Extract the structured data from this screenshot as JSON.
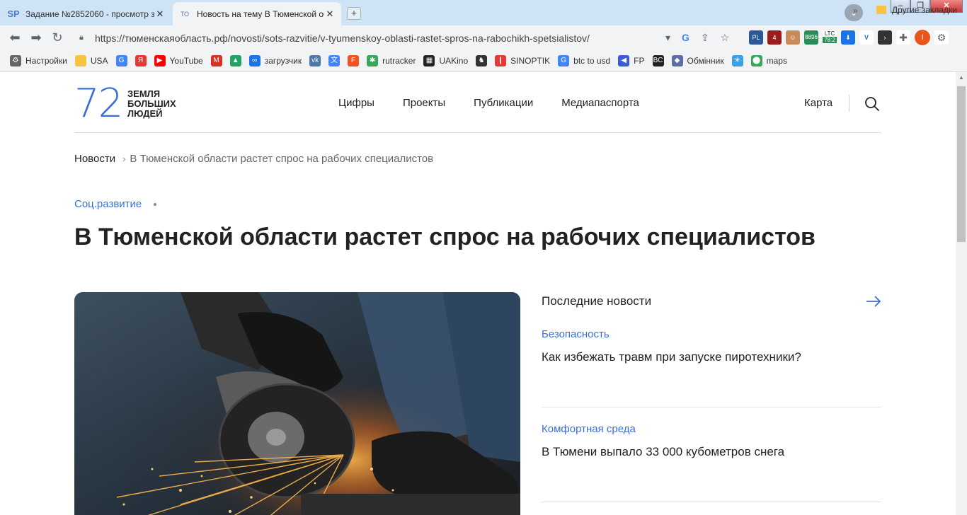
{
  "browser": {
    "tabs": [
      {
        "favicon": "SP",
        "title": "Задание №2852060 - просмотр з"
      },
      {
        "favicon": "ТО",
        "title": "Новость на тему В Тюменской об"
      }
    ],
    "url": "https://тюменскаяобласть.рф/novosti/sots-razvitie/v-tyumenskoy-oblasti-rastet-spros-na-rabochikh-spetsialistov/",
    "extensions": {
      "ltc_label": "LTC",
      "ltc_value": "78.2",
      "badge_4": "4",
      "badge_pl": "PL",
      "badge_value": "8896",
      "avatar_letter": "I"
    },
    "bookmarks": [
      {
        "label": "Настройки",
        "icon": "gear-icon",
        "color": "#666666"
      },
      {
        "label": "USA",
        "icon": "folder-icon",
        "color": "#f5c542"
      },
      {
        "label": "",
        "icon": "google-icon",
        "color": "#4285f4"
      },
      {
        "label": "",
        "icon": "yandex-icon",
        "color": "#e53935"
      },
      {
        "label": "YouTube",
        "icon": "youtube-icon",
        "color": "#ff0000"
      },
      {
        "label": "",
        "icon": "gmail-icon",
        "color": "#d93025"
      },
      {
        "label": "",
        "icon": "drive-icon",
        "color": "#1fa463"
      },
      {
        "label": "загрузчик",
        "icon": "infinity-icon",
        "color": "#1a73e8"
      },
      {
        "label": "",
        "icon": "vk-icon",
        "color": "#4a76a8"
      },
      {
        "label": "",
        "icon": "translate-icon",
        "color": "#4285f4"
      },
      {
        "label": "",
        "icon": "f-icon",
        "color": "#f4511e"
      },
      {
        "label": "rutracker",
        "icon": "rutracker-icon",
        "color": "#3aa757"
      },
      {
        "label": "UAKino",
        "icon": "uakino-icon",
        "color": "#222222"
      },
      {
        "label": "",
        "icon": "chess-icon",
        "color": "#333333"
      },
      {
        "label": "SINOPTIK",
        "icon": "thermometer-icon",
        "color": "#e53935"
      },
      {
        "label": "btc to usd",
        "icon": "google-icon",
        "color": "#4285f4"
      },
      {
        "label": "FP",
        "icon": "fp-icon",
        "color": "#3b5bdb"
      },
      {
        "label": "",
        "icon": "bc-icon",
        "color": "#222222"
      },
      {
        "label": "Обмінник",
        "icon": "exchange-icon",
        "color": "#5b6ea8"
      },
      {
        "label": "",
        "icon": "snowflake-icon",
        "color": "#3aa0e8"
      },
      {
        "label": "maps",
        "icon": "maps-icon",
        "color": "#34a853"
      }
    ],
    "bookmarks_more": "»",
    "other_bookmarks": "Другие закладки"
  },
  "site": {
    "logo_number": "72",
    "logo_lines": [
      "ЗЕМЛЯ",
      "БОЛЬШИХ",
      "ЛЮДЕЙ"
    ],
    "nav": [
      "Цифры",
      "Проекты",
      "Публикации",
      "Медиапаспорта"
    ],
    "map_link": "Карта",
    "accent_color": "#3a6fd8"
  },
  "breadcrumb": {
    "root": "Новости",
    "current": "В Тюменской области растет спрос на рабочих специалистов"
  },
  "article": {
    "category": "Соц.развитие",
    "title": "В Тюменской области растет спрос на рабочих специалистов",
    "image_alt": "worker-grinding-metal-sparks"
  },
  "latest_news": {
    "heading": "Последние новости",
    "items": [
      {
        "category": "Безопасность",
        "title": "Как избежать травм при запуске пиротехники?"
      },
      {
        "category": "Комфортная среда",
        "title": "В Тюмени выпало 33 000 кубометров снега"
      }
    ]
  }
}
